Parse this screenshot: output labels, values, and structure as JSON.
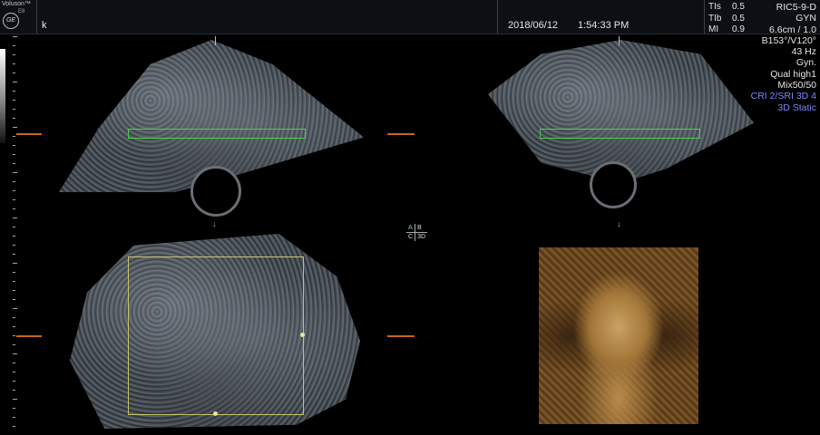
{
  "topbar": {
    "brand": "Voluson™",
    "model": "E8",
    "logo": "GE",
    "mode_label": "k",
    "date": "2018/06/12",
    "time": "1:54:33 PM"
  },
  "thermal": [
    {
      "label": "TIs",
      "value": "0.5"
    },
    {
      "label": "TIb",
      "value": "0.5"
    },
    {
      "label": "MI",
      "value": "0.9"
    }
  ],
  "settings": {
    "probe": "RIC5-9-D",
    "preset": "GYN",
    "depth": "6.6cm / 1.0",
    "angles": "B153°/V120°",
    "frequency": "43 Hz",
    "mode": "Gyn.",
    "quality": "Qual high1",
    "mix": "Mix50/50",
    "cri": "CRI 2/SRI 3D 4",
    "acq": "3D Static"
  },
  "quadrants": {
    "a": "A",
    "b": "B",
    "c": "C",
    "d": "3D"
  },
  "icons": {
    "arrow": "down-arrow-icon",
    "marker": "orange-position-marker-icon"
  }
}
